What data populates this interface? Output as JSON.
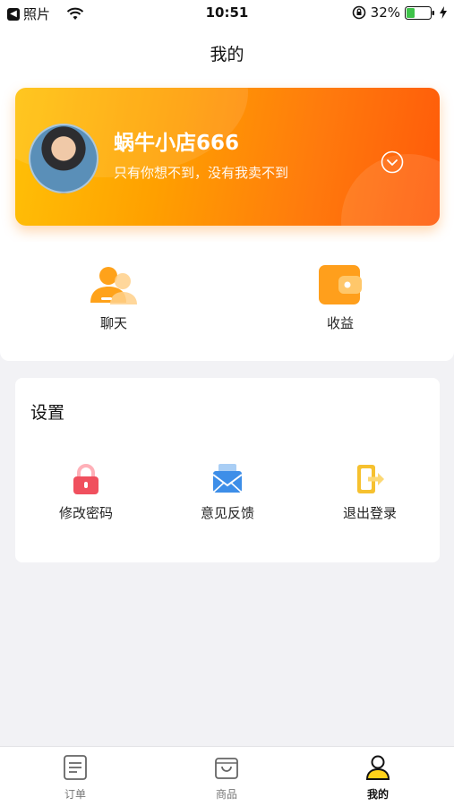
{
  "status_bar": {
    "back_app": "照片",
    "time": "10:51",
    "battery": "32%"
  },
  "header": {
    "title": "我的"
  },
  "profile": {
    "shop_name": "蜗牛小店666",
    "slogan": "只有你想不到，没有我卖不到"
  },
  "quick_actions": [
    {
      "label": "聊天",
      "icon": "chat-user-icon"
    },
    {
      "label": "收益",
      "icon": "wallet-icon"
    }
  ],
  "settings": {
    "title": "设置",
    "items": [
      {
        "label": "修改密码",
        "icon": "lock-icon"
      },
      {
        "label": "意见反馈",
        "icon": "mail-icon"
      },
      {
        "label": "退出登录",
        "icon": "logout-icon"
      }
    ]
  },
  "tab_bar": {
    "items": [
      {
        "label": "订单",
        "icon": "order-icon"
      },
      {
        "label": "商品",
        "icon": "bag-icon"
      },
      {
        "label": "我的",
        "icon": "user-icon"
      }
    ],
    "active": "我的"
  },
  "colors": {
    "accent": "#ffa000",
    "card_end": "#ff5a0a",
    "background": "#f2f2f5"
  }
}
